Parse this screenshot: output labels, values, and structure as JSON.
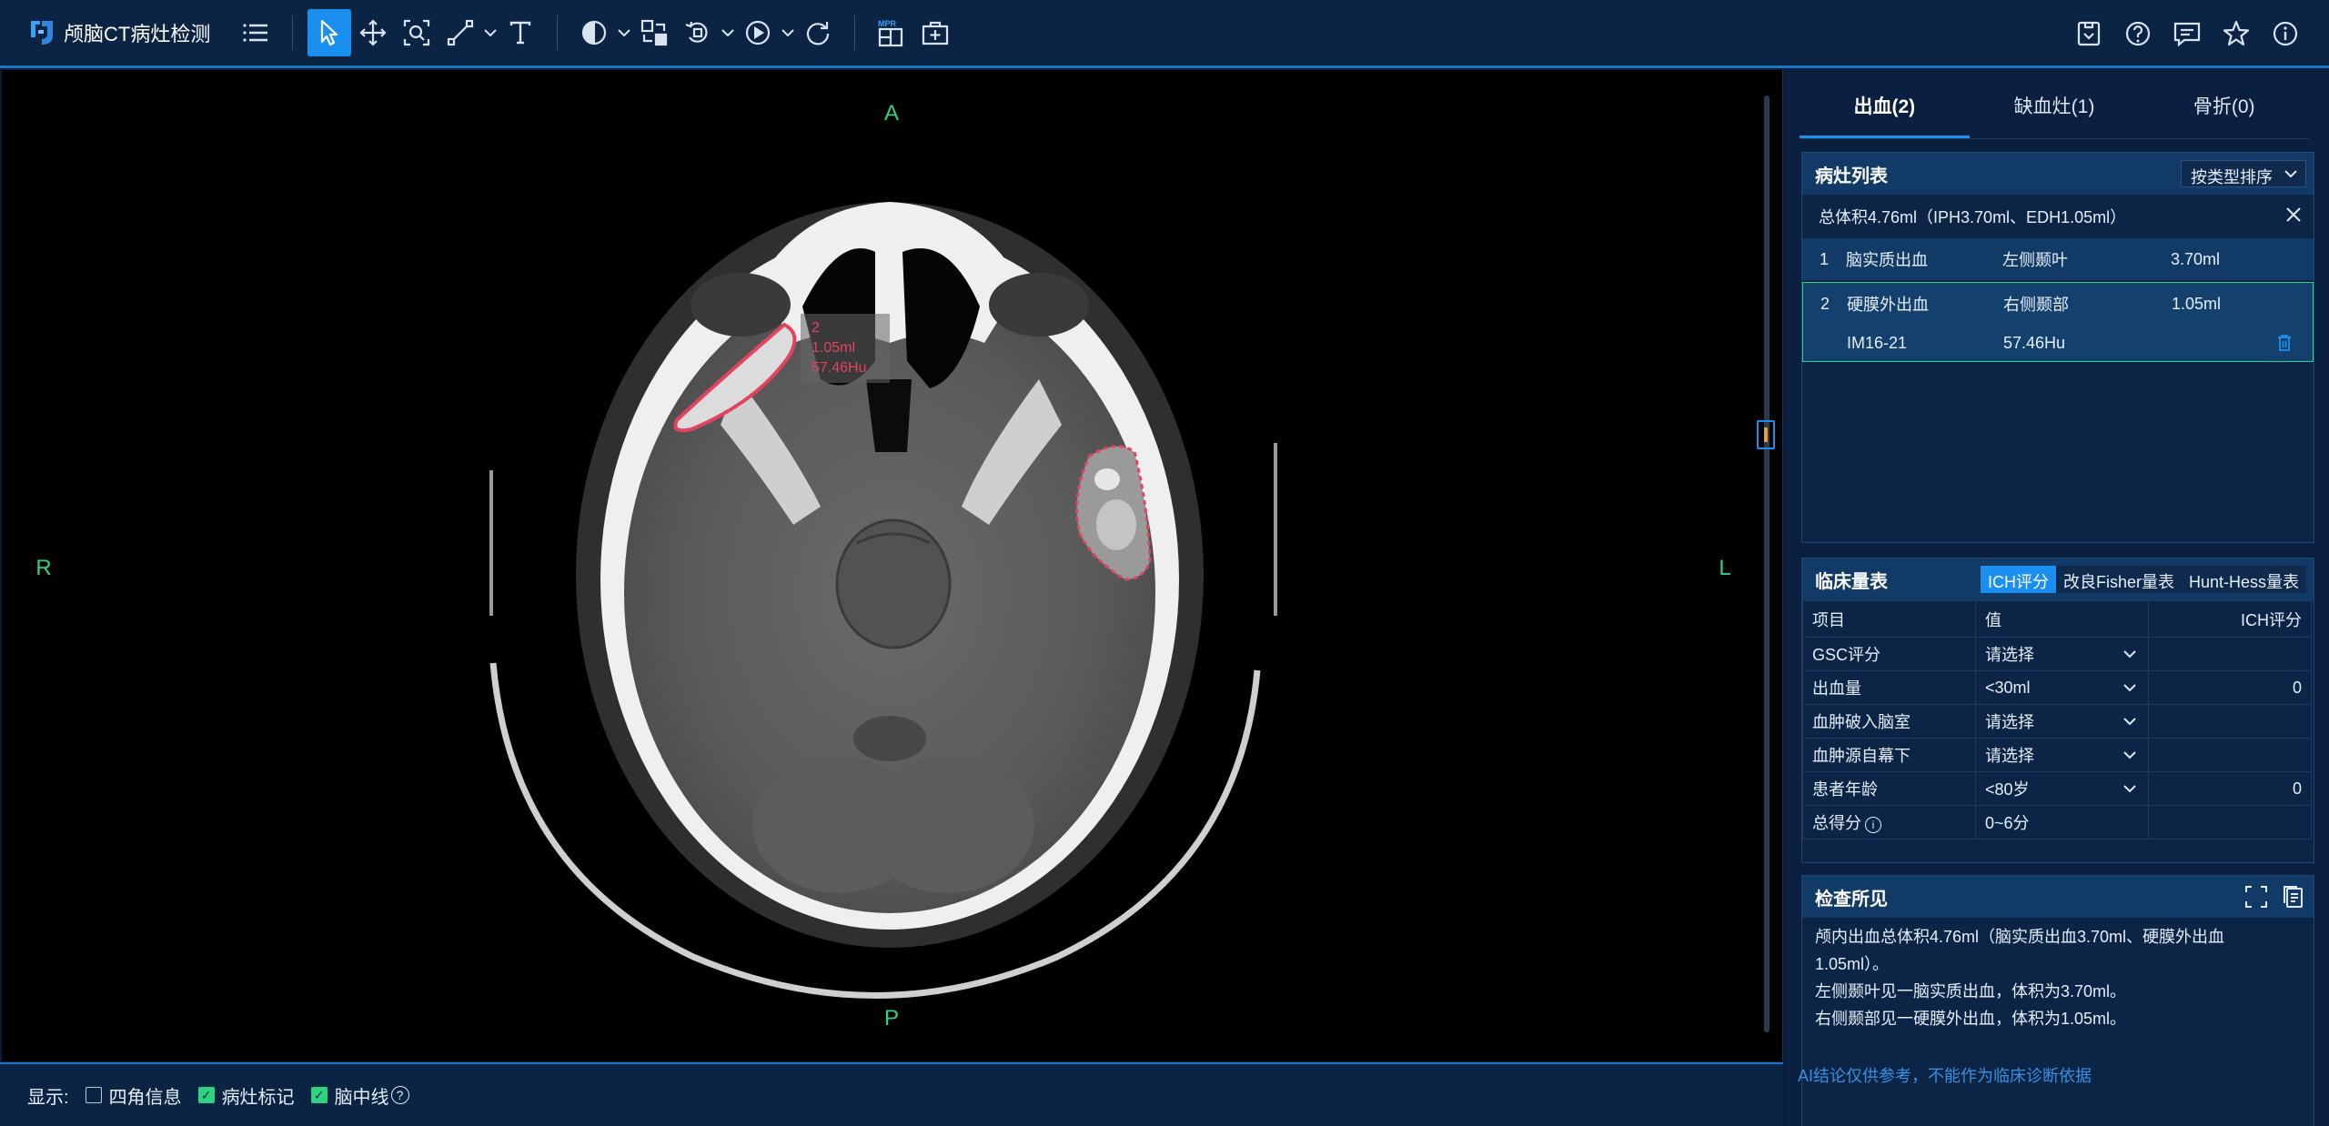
{
  "app": {
    "title": "颅脑CT病灶检测"
  },
  "viewer": {
    "orientation": {
      "top": "A",
      "bottom": "P",
      "left": "R",
      "right": "L"
    },
    "lesion_label": {
      "index": "2",
      "volume": "1.05ml",
      "hu": "57.46Hu"
    }
  },
  "display_bar": {
    "label": "显示:",
    "options": [
      {
        "label": "四角信息",
        "checked": false
      },
      {
        "label": "病灶标记",
        "checked": true
      },
      {
        "label": "脑中线",
        "checked": true
      }
    ],
    "help_glyph": "?"
  },
  "tabs": [
    {
      "label": "出血(2)",
      "active": true
    },
    {
      "label": "缺血灶(1)",
      "active": false
    },
    {
      "label": "骨折(0)",
      "active": false
    }
  ],
  "lesion_list": {
    "title": "病灶列表",
    "sort_label": "按类型排序",
    "total": "总体积4.76ml（IPH3.70ml、EDH1.05ml）",
    "rows": [
      {
        "no": "1",
        "type": "脑实质出血",
        "location": "左侧颞叶",
        "volume": "3.70ml"
      },
      {
        "no": "2",
        "type": "硬膜外出血",
        "location": "右侧颞部",
        "volume": "1.05ml"
      }
    ],
    "selected_detail": {
      "images": "IM16-21",
      "hu": "57.46Hu"
    }
  },
  "clinical_scale": {
    "title": "临床量表",
    "scale_tabs": [
      {
        "label": "ICH评分",
        "active": true
      },
      {
        "label": "改良Fisher量表",
        "active": false
      },
      {
        "label": "Hunt-Hess量表",
        "active": false
      }
    ],
    "columns": [
      "项目",
      "值",
      "ICH评分"
    ],
    "rows": [
      {
        "item": "GSC评分",
        "value": "请选择",
        "score": ""
      },
      {
        "item": "出血量",
        "value": "<30ml",
        "score": "0"
      },
      {
        "item": "血肿破入脑室",
        "value": "请选择",
        "score": ""
      },
      {
        "item": "血肿源自幕下",
        "value": "请选择",
        "score": ""
      },
      {
        "item": "患者年龄",
        "value": "<80岁",
        "score": "0"
      }
    ],
    "total": {
      "item": "总得分",
      "value": "0~6分",
      "info_glyph": "i"
    }
  },
  "findings": {
    "title": "检查所见",
    "lines": [
      "颅内出血总体积4.76ml（脑实质出血3.70ml、硬膜外出血",
      "1.05ml）。",
      "左侧颞叶见一脑实质出血，体积为3.70ml。",
      "右侧颞部见一硬膜外出血，体积为1.05ml。"
    ]
  },
  "disclaimer": "AI结论仅供参考，不能作为临床诊断依据",
  "toolbar": {
    "tools": [
      "menu-icon",
      "pointer-icon",
      "pan-icon",
      "zoom-icon",
      "measure-icon",
      "text-icon",
      "window-level-icon",
      "invert-icon",
      "rotate-icon",
      "play-icon",
      "reset-icon",
      "mpr-icon",
      "medkit-icon"
    ],
    "right": [
      "inbox-icon",
      "help-icon",
      "report-icon",
      "star-icon",
      "info-icon"
    ],
    "mpr_text": "MPR"
  },
  "colors": {
    "accent": "#1a8ff0",
    "orientation": "#2fd27e",
    "lesion": "#e0445e",
    "disclaimer": "#3b8fe0"
  }
}
